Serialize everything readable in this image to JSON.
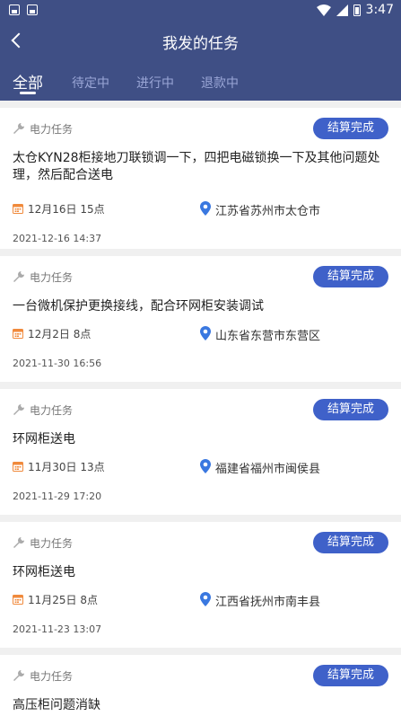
{
  "status_bar": {
    "time": "3:47"
  },
  "nav": {
    "title": "我发的任务"
  },
  "tabs": [
    {
      "label": "全部"
    },
    {
      "label": "待定中"
    },
    {
      "label": "进行中"
    },
    {
      "label": "退款中"
    }
  ],
  "colors": {
    "header": "#3f4f85",
    "badge": "#3f61c9",
    "pin": "#3a78e0",
    "calendar": "#f08a3c"
  },
  "tasks": [
    {
      "type": "电力任务",
      "status": "结算完成",
      "title": "太仓KYN28柜接地刀联锁调一下，四把电磁锁换一下及其他问题处理，然后配合送电",
      "date": "12月16日 15点",
      "location": "江苏省苏州市太仓市",
      "created": "2021-12-16 14:37"
    },
    {
      "type": "电力任务",
      "status": "结算完成",
      "title": "一台微机保护更换接线，配合环网柜安装调试",
      "date": "12月2日 8点",
      "location": "山东省东营市东营区",
      "created": "2021-11-30 16:56"
    },
    {
      "type": "电力任务",
      "status": "结算完成",
      "title": "环网柜送电",
      "date": "11月30日 13点",
      "location": "福建省福州市闽侯县",
      "created": "2021-11-29 17:20"
    },
    {
      "type": "电力任务",
      "status": "结算完成",
      "title": "环网柜送电",
      "date": "11月25日 8点",
      "location": "江西省抚州市南丰县",
      "created": "2021-11-23 13:07"
    },
    {
      "type": "电力任务",
      "status": "结算完成",
      "title": "高压柜问题消缺"
    }
  ]
}
